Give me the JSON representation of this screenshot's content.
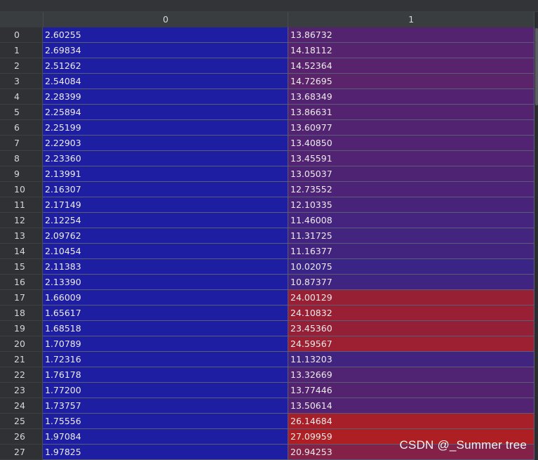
{
  "columns": [
    "0",
    "1"
  ],
  "rows": [
    {
      "index": "0",
      "c0": "2.60255",
      "c1": "13.86732"
    },
    {
      "index": "1",
      "c0": "2.69834",
      "c1": "14.18112"
    },
    {
      "index": "2",
      "c0": "2.51262",
      "c1": "14.52364"
    },
    {
      "index": "3",
      "c0": "2.54084",
      "c1": "14.72695"
    },
    {
      "index": "4",
      "c0": "2.28399",
      "c1": "13.68349"
    },
    {
      "index": "5",
      "c0": "2.25894",
      "c1": "13.86631"
    },
    {
      "index": "6",
      "c0": "2.25199",
      "c1": "13.60977"
    },
    {
      "index": "7",
      "c0": "2.22903",
      "c1": "13.40850"
    },
    {
      "index": "8",
      "c0": "2.23360",
      "c1": "13.45591"
    },
    {
      "index": "9",
      "c0": "2.13991",
      "c1": "13.05037"
    },
    {
      "index": "10",
      "c0": "2.16307",
      "c1": "12.73552"
    },
    {
      "index": "11",
      "c0": "2.17149",
      "c1": "12.10335"
    },
    {
      "index": "12",
      "c0": "2.12254",
      "c1": "11.46008"
    },
    {
      "index": "13",
      "c0": "2.09762",
      "c1": "11.31725"
    },
    {
      "index": "14",
      "c0": "2.10454",
      "c1": "11.16377"
    },
    {
      "index": "15",
      "c0": "2.11383",
      "c1": "10.02075"
    },
    {
      "index": "16",
      "c0": "2.13390",
      "c1": "10.87377"
    },
    {
      "index": "17",
      "c0": "1.66009",
      "c1": "24.00129"
    },
    {
      "index": "18",
      "c0": "1.65617",
      "c1": "24.10832"
    },
    {
      "index": "19",
      "c0": "1.68518",
      "c1": "23.45360"
    },
    {
      "index": "20",
      "c0": "1.70789",
      "c1": "24.59567"
    },
    {
      "index": "21",
      "c0": "1.72316",
      "c1": "11.13203"
    },
    {
      "index": "22",
      "c0": "1.76178",
      "c1": "13.32669"
    },
    {
      "index": "23",
      "c0": "1.77200",
      "c1": "13.77446"
    },
    {
      "index": "24",
      "c0": "1.73757",
      "c1": "13.50614"
    },
    {
      "index": "25",
      "c0": "1.75556",
      "c1": "26.14684"
    },
    {
      "index": "26",
      "c0": "1.97084",
      "c1": "27.09959"
    },
    {
      "index": "27",
      "c0": "1.97825",
      "c1": "20.94253"
    }
  ],
  "colors": {
    "col0_background": "#1e1ea2",
    "col1_low": "#3a2486",
    "col1_high": "#ad1f22"
  },
  "watermark": "CSDN @_Summer tree"
}
